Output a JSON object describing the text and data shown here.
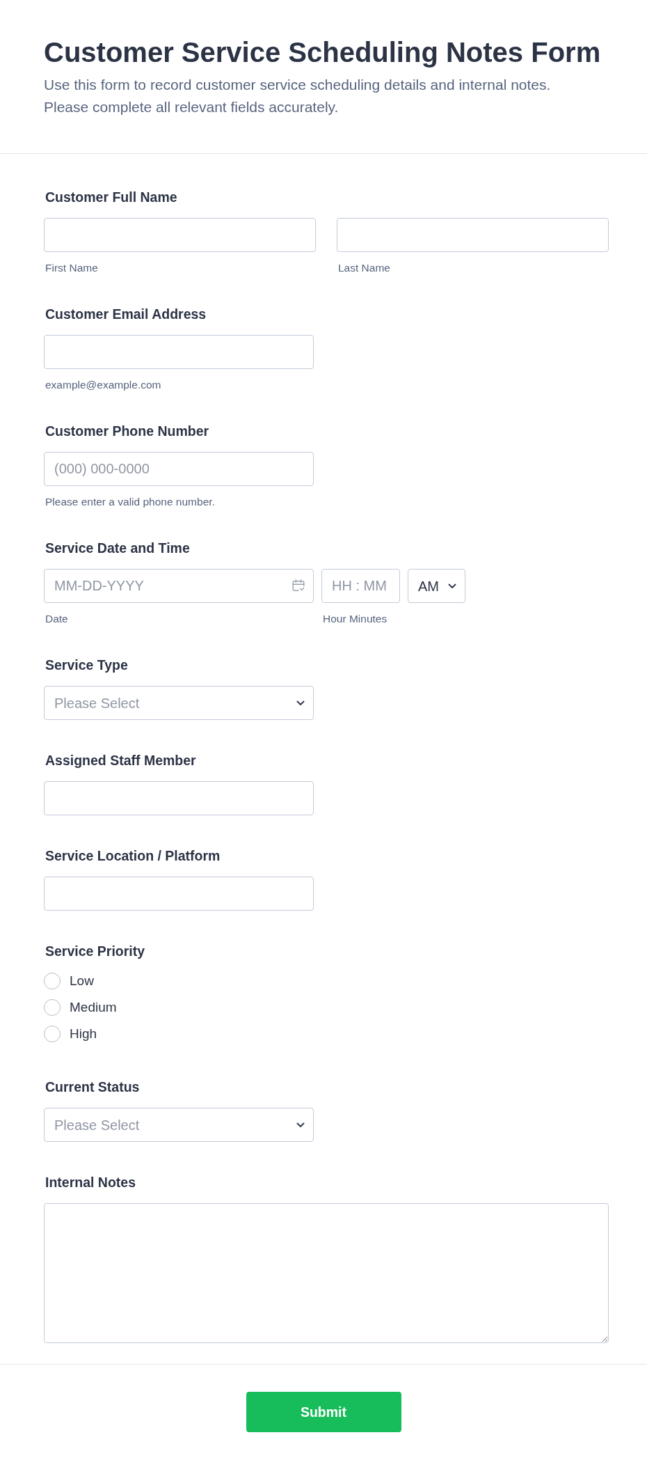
{
  "header": {
    "title": "Customer Service Scheduling Notes Form",
    "description": [
      "Use this form to record customer service scheduling details and internal notes.",
      "Please complete all relevant fields accurately."
    ]
  },
  "fields": [
    {
      "kind": "name",
      "label": "Customer Full Name",
      "inputs": [
        {
          "sublabel": "First Name"
        },
        {
          "sublabel": "Last Name"
        }
      ]
    },
    {
      "kind": "text",
      "label": "Customer Email Address",
      "sublabel": "example@example.com"
    },
    {
      "kind": "text",
      "label": "Customer Phone Number",
      "placeholder": "(000) 000-0000",
      "sublabel": "Please enter a valid phone number."
    },
    {
      "kind": "datetime",
      "label": "Service Date and Time",
      "date": {
        "placeholder": "MM-DD-YYYY",
        "sublabel": "Date"
      },
      "time": {
        "placeholder": "HH : MM",
        "sublabel": "Hour Minutes"
      },
      "period": {
        "value": "AM"
      }
    },
    {
      "kind": "select",
      "label": "Service Type",
      "placeholder": "Please Select"
    },
    {
      "kind": "text",
      "label": "Assigned Staff Member"
    },
    {
      "kind": "text",
      "label": "Service Location / Platform"
    },
    {
      "kind": "radio",
      "label": "Service Priority",
      "options": [
        {
          "label": "Low",
          "selected": false
        },
        {
          "label": "Medium",
          "selected": false
        },
        {
          "label": "High",
          "selected": false
        }
      ]
    },
    {
      "kind": "select",
      "label": "Current Status",
      "placeholder": "Please Select"
    },
    {
      "kind": "textarea",
      "label": "Internal Notes"
    }
  ],
  "submit": {
    "label": "Submit"
  }
}
